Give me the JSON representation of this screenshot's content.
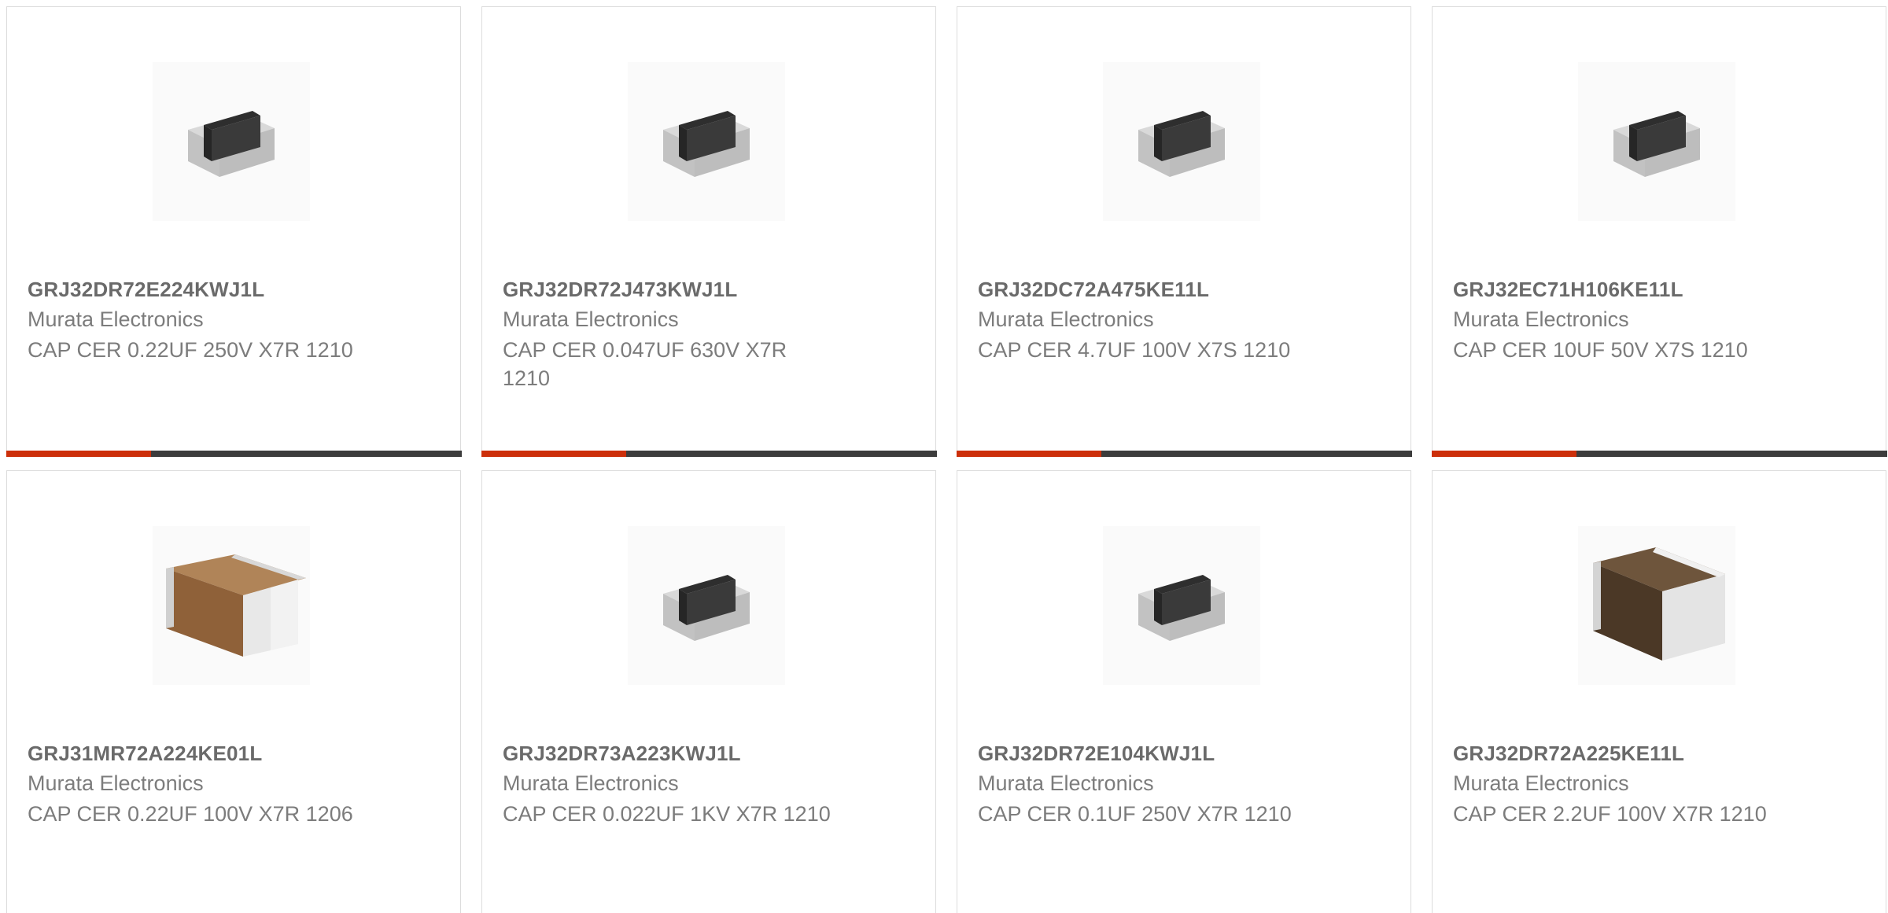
{
  "accent_color": "#cc2f0a",
  "bar_color": "#3c3c3c",
  "products": [
    {
      "part_number": "GRJ32DR72E224KWJ1L",
      "manufacturer": "Murata Electronics",
      "description": "CAP CER 0.22UF 250V X7R 1210",
      "image": "dark-mlcc-chip"
    },
    {
      "part_number": "GRJ32DR72J473KWJ1L",
      "manufacturer": "Murata Electronics",
      "description": "CAP CER 0.047UF 630V X7R 1210",
      "image": "dark-mlcc-chip"
    },
    {
      "part_number": "GRJ32DC72A475KE11L",
      "manufacturer": "Murata Electronics",
      "description": "CAP CER 4.7UF 100V X7S 1210",
      "image": "dark-mlcc-chip"
    },
    {
      "part_number": "GRJ32EC71H106KE11L",
      "manufacturer": "Murata Electronics",
      "description": "CAP CER 10UF 50V X7S 1210",
      "image": "dark-mlcc-chip"
    },
    {
      "part_number": "GRJ31MR72A224KE01L",
      "manufacturer": "Murata Electronics",
      "description": "CAP CER 0.22UF 100V X7R 1206",
      "image": "tan-mlcc-chip"
    },
    {
      "part_number": "GRJ32DR73A223KWJ1L",
      "manufacturer": "Murata Electronics",
      "description": "CAP CER 0.022UF 1KV X7R 1210",
      "image": "dark-mlcc-chip"
    },
    {
      "part_number": "GRJ32DR72E104KWJ1L",
      "manufacturer": "Murata Electronics",
      "description": "CAP CER 0.1UF 250V X7R 1210",
      "image": "dark-mlcc-chip"
    },
    {
      "part_number": "GRJ32DR72A225KE11L",
      "manufacturer": "Murata Electronics",
      "description": "CAP CER 2.2UF 100V X7R 1210",
      "image": "brown-mlcc-chip"
    }
  ]
}
